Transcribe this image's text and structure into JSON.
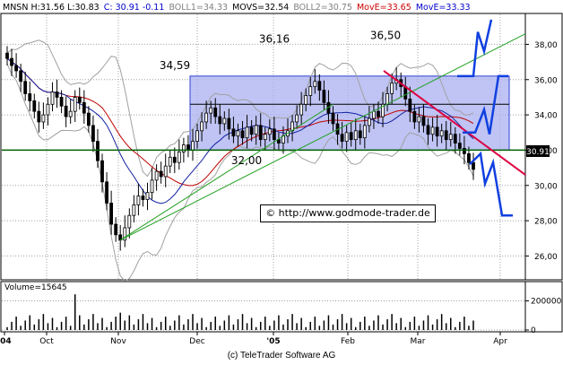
{
  "header": {
    "instrument": "MNSN H:31.56 L:30.83",
    "change": "C: 30.91 -0.11",
    "boll1": "BOLL1=34.33",
    "movs": "MOVS=32.54",
    "boll2": "BOLL2=30.75",
    "move1": "MovE=33.65",
    "move2": "MovE=33.33"
  },
  "colors": {
    "boll": "#a0a0a0",
    "movs": "#000000",
    "move_red": "#c00000",
    "move_blue": "#1020a0",
    "header_blue": "#0000cc",
    "header_red": "#cc0000",
    "box_fill": "#aab0f0",
    "trend_green": "#22a022",
    "forecast_blue": "#1040e0",
    "resistance_red": "#dd0040"
  },
  "watermark": "© http://www.godmode-trader.de",
  "volume_label": "Volume=15645",
  "footer": "(c) TeleTrader Software AG",
  "chart_data": {
    "type": "candlestick",
    "instrument": "MNSN",
    "last_price_tag": "30.91",
    "y_ticks": [
      "38,00",
      "36,00",
      "34,00",
      "32,00",
      "30,00",
      "28,00",
      "26,00"
    ],
    "y_range": [
      24.7,
      39.7
    ],
    "x_ticks": [
      "'04",
      "Oct",
      "Nov",
      "Dec",
      "'05",
      "Feb",
      "Mar",
      "Apr"
    ],
    "annotations": [
      "34,59",
      "36,16",
      "32,00",
      "36,50"
    ],
    "levels": [
      36.2,
      34.6,
      32.0
    ],
    "volume_ticks": [
      "200000",
      "0"
    ],
    "price_closes": [
      37.2,
      36.8,
      36.5,
      35.9,
      35.2,
      34.8,
      34.2,
      33.6,
      34.0,
      34.6,
      35.3,
      35.0,
      34.5,
      33.9,
      34.2,
      35.0,
      34.7,
      34.1,
      33.4,
      32.5,
      31.4,
      30.2,
      29.0,
      27.8,
      27.2,
      26.9,
      27.6,
      28.3,
      28.9,
      29.4,
      29.2,
      29.6,
      30.3,
      30.8,
      30.5,
      31.1,
      31.6,
      31.3,
      31.9,
      32.3,
      32.0,
      32.5,
      33.1,
      33.6,
      34.1,
      34.4,
      33.9,
      33.5,
      33.8,
      33.2,
      32.8,
      33.1,
      32.7,
      33.3,
      32.9,
      33.4,
      32.6,
      32.9,
      33.2,
      32.6,
      32.4,
      32.8,
      33.1,
      33.6,
      34.0,
      34.6,
      35.1,
      35.6,
      35.9,
      35.4,
      34.7,
      34.1,
      33.5,
      32.9,
      32.5,
      33.0,
      32.6,
      33.1,
      32.7,
      33.4,
      33.8,
      34.2,
      33.9,
      34.6,
      35.2,
      35.8,
      36.0,
      35.6,
      34.9,
      34.2,
      33.6,
      33.9,
      33.4,
      32.9,
      33.3,
      32.8,
      33.1,
      32.6,
      32.9,
      32.4,
      32.1,
      31.8,
      31.3,
      30.91
    ]
  }
}
